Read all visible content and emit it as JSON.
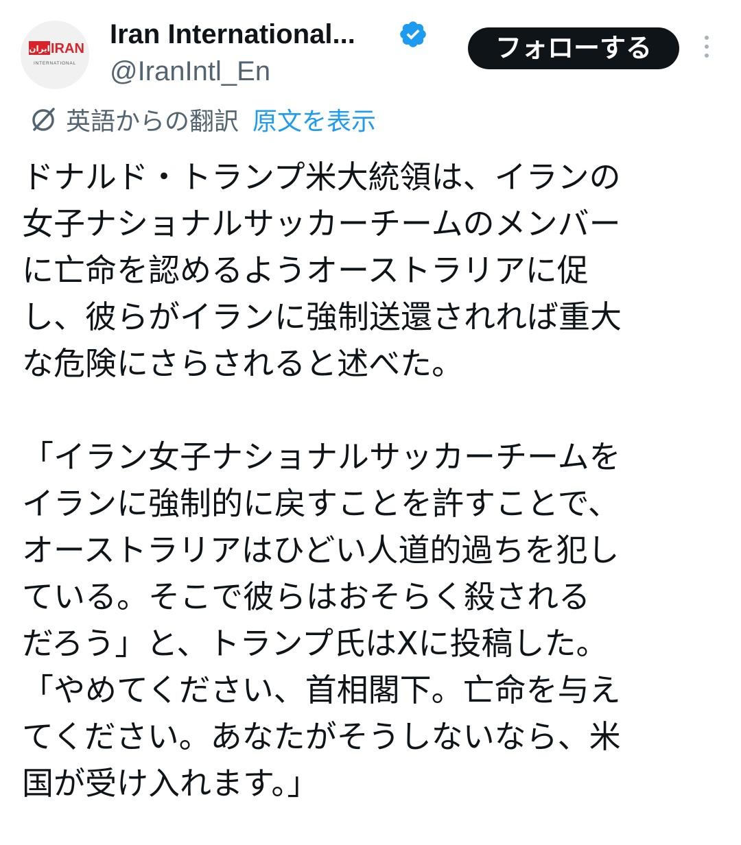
{
  "author": {
    "display_name": "Iran International...",
    "handle": "@IranIntl_En",
    "verified": true,
    "avatar": {
      "icon": "iran-international-logo",
      "logo_text_main": "IRAN",
      "logo_text_persian": "ایران",
      "logo_text_sub": "INTERNATIONAL"
    }
  },
  "actions": {
    "follow_label": "フォローする",
    "more_icon": "more-vertical-icon"
  },
  "translation": {
    "icon": "translate-icon",
    "label": "英語からの翻訳",
    "show_original": "原文を表示"
  },
  "tweet": {
    "paragraph_1": "ドナルド・トランプ米大統領は、イランの\n女子ナショナルサッカーチームのメンバー\nに亡命を認めるようオーストラリアに促\nし、彼らがイランに強制送還されれば重大\nな危険にさらされると述べた。",
    "paragraph_2": "「イラン女子ナショナルサッカーチームを\nイランに強制的に戻すことを許すことで、\nオーストラリアはひどい人道的過ちを犯し\nている。そこで彼らはおそらく殺される\nだろう」と、トランプ氏はXに投稿した。\n「やめてください、首相閣下。亡命を与え\nてください。あなたがそうしないなら、米\n国が受け入れます。」"
  },
  "colors": {
    "text_primary": "#0f1419",
    "text_secondary": "#536471",
    "link": "#1d9bf0",
    "verified_badge": "#1d9bf0",
    "logo_red": "#d8232a"
  }
}
